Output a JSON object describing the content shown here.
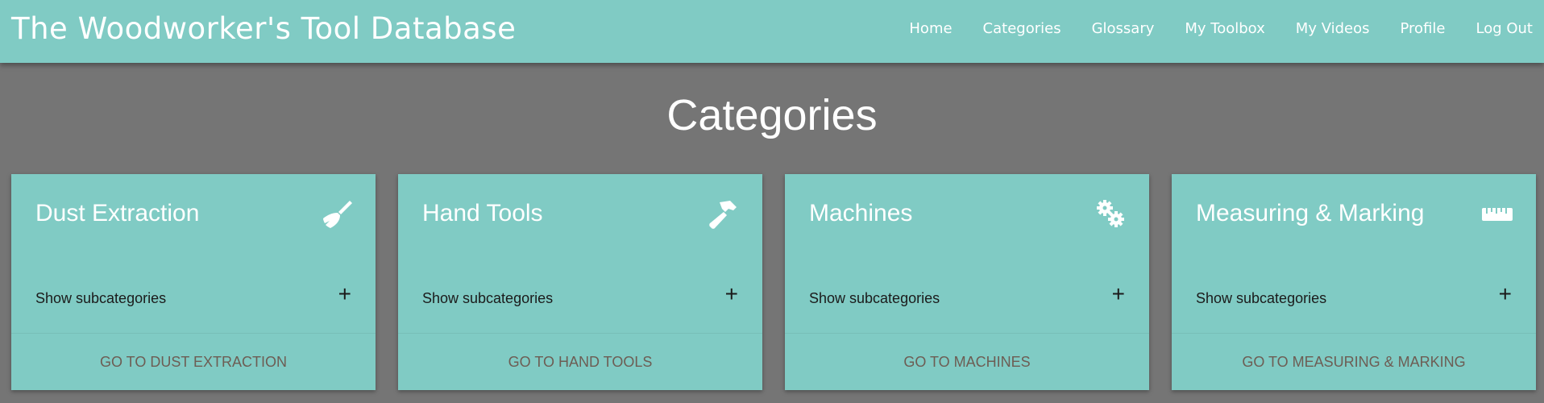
{
  "navbar": {
    "brand": "The Woodworker's Tool Database",
    "links": [
      "Home",
      "Categories",
      "Glossary",
      "My Toolbox",
      "My Videos",
      "Profile",
      "Log Out"
    ]
  },
  "page": {
    "title": "Categories"
  },
  "colors": {
    "accent": "#80cbc4",
    "background": "#757575",
    "action_text": "#6d5d54"
  },
  "cards": [
    {
      "title": "Dust Extraction",
      "icon": "broom-icon",
      "subcategories_label": "Show subcategories",
      "action_label": "GO TO DUST EXTRACTION"
    },
    {
      "title": "Hand Tools",
      "icon": "hammer-icon",
      "subcategories_label": "Show subcategories",
      "action_label": "GO TO HAND TOOLS"
    },
    {
      "title": "Machines",
      "icon": "gears-icon",
      "subcategories_label": "Show subcategories",
      "action_label": "GO TO MACHINES"
    },
    {
      "title": "Measuring & Marking",
      "icon": "ruler-icon",
      "subcategories_label": "Show subcategories",
      "action_label": "GO TO MEASURING & MARKING"
    }
  ]
}
